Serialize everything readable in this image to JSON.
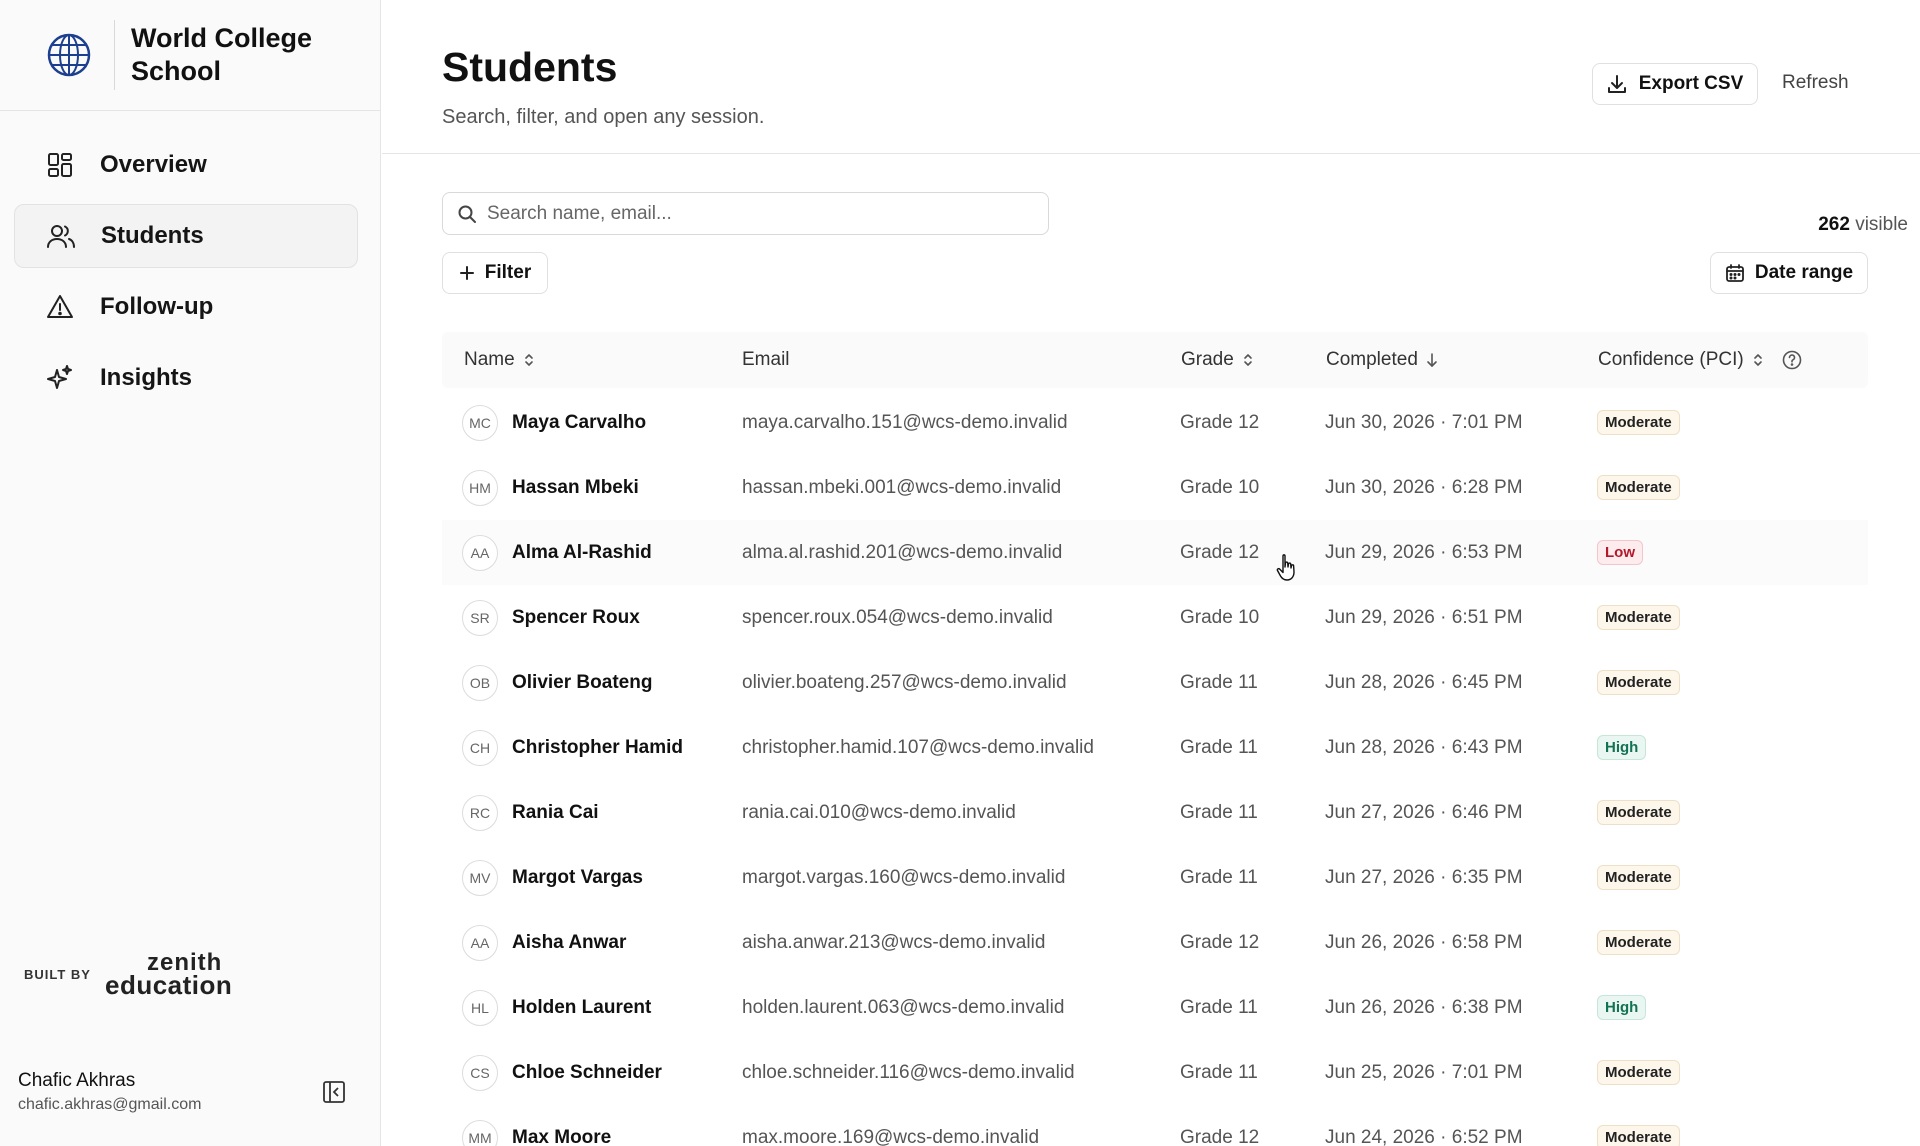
{
  "sidebar": {
    "brand_name": "World College School",
    "nav": [
      {
        "label": "Overview",
        "icon": "grid-icon",
        "active": false
      },
      {
        "label": "Students",
        "icon": "users-icon",
        "active": true
      },
      {
        "label": "Follow-up",
        "icon": "warning-icon",
        "active": false
      },
      {
        "label": "Insights",
        "icon": "sparkles-icon",
        "active": false
      }
    ],
    "built_by_label": "BUILT BY",
    "built_by_brand": "zenith education",
    "built_by_line1": "zenith",
    "built_by_line2": "education",
    "user": {
      "name": "Chafic Akhras",
      "email": "chafic.akhras@gmail.com"
    }
  },
  "header": {
    "title": "Students",
    "subtitle": "Search, filter, and open any session.",
    "export_label": "Export CSV",
    "refresh_label": "Refresh"
  },
  "toolbar": {
    "search_placeholder": "Search name, email...",
    "search_value": "",
    "visible_count": "262",
    "visible_suffix": "visible",
    "filter_label": "Filter",
    "date_range_label": "Date range"
  },
  "table": {
    "columns": {
      "name": "Name",
      "email": "Email",
      "grade": "Grade",
      "completed": "Completed",
      "confidence": "Confidence (PCI)"
    },
    "rows": [
      {
        "initials": "MC",
        "name": "Maya Carvalho",
        "email": "maya.carvalho.151@wcs-demo.invalid",
        "grade": "Grade 12",
        "completed": "Jun 30, 2026 · 7:01 PM",
        "confidence": "Moderate",
        "level": "moderate"
      },
      {
        "initials": "HM",
        "name": "Hassan Mbeki",
        "email": "hassan.mbeki.001@wcs-demo.invalid",
        "grade": "Grade 10",
        "completed": "Jun 30, 2026 · 6:28 PM",
        "confidence": "Moderate",
        "level": "moderate"
      },
      {
        "initials": "AA",
        "name": "Alma Al-Rashid",
        "email": "alma.al.rashid.201@wcs-demo.invalid",
        "grade": "Grade 12",
        "completed": "Jun 29, 2026 · 6:53 PM",
        "confidence": "Low",
        "level": "low"
      },
      {
        "initials": "SR",
        "name": "Spencer Roux",
        "email": "spencer.roux.054@wcs-demo.invalid",
        "grade": "Grade 10",
        "completed": "Jun 29, 2026 · 6:51 PM",
        "confidence": "Moderate",
        "level": "moderate"
      },
      {
        "initials": "OB",
        "name": "Olivier Boateng",
        "email": "olivier.boateng.257@wcs-demo.invalid",
        "grade": "Grade 11",
        "completed": "Jun 28, 2026 · 6:45 PM",
        "confidence": "Moderate",
        "level": "moderate"
      },
      {
        "initials": "CH",
        "name": "Christopher Hamid",
        "email": "christopher.hamid.107@wcs-demo.invalid",
        "grade": "Grade 11",
        "completed": "Jun 28, 2026 · 6:43 PM",
        "confidence": "High",
        "level": "high"
      },
      {
        "initials": "RC",
        "name": "Rania Cai",
        "email": "rania.cai.010@wcs-demo.invalid",
        "grade": "Grade 11",
        "completed": "Jun 27, 2026 · 6:46 PM",
        "confidence": "Moderate",
        "level": "moderate"
      },
      {
        "initials": "MV",
        "name": "Margot Vargas",
        "email": "margot.vargas.160@wcs-demo.invalid",
        "grade": "Grade 11",
        "completed": "Jun 27, 2026 · 6:35 PM",
        "confidence": "Moderate",
        "level": "moderate"
      },
      {
        "initials": "AA",
        "name": "Aisha Anwar",
        "email": "aisha.anwar.213@wcs-demo.invalid",
        "grade": "Grade 12",
        "completed": "Jun 26, 2026 · 6:58 PM",
        "confidence": "Moderate",
        "level": "moderate"
      },
      {
        "initials": "HL",
        "name": "Holden Laurent",
        "email": "holden.laurent.063@wcs-demo.invalid",
        "grade": "Grade 11",
        "completed": "Jun 26, 2026 · 6:38 PM",
        "confidence": "High",
        "level": "high"
      },
      {
        "initials": "CS",
        "name": "Chloe Schneider",
        "email": "chloe.schneider.116@wcs-demo.invalid",
        "grade": "Grade 11",
        "completed": "Jun 25, 2026 · 7:01 PM",
        "confidence": "Moderate",
        "level": "moderate"
      },
      {
        "initials": "MM",
        "name": "Max Moore",
        "email": "max.moore.169@wcs-demo.invalid",
        "grade": "Grade 12",
        "completed": "Jun 24, 2026 · 6:52 PM",
        "confidence": "Moderate",
        "level": "moderate"
      }
    ]
  }
}
